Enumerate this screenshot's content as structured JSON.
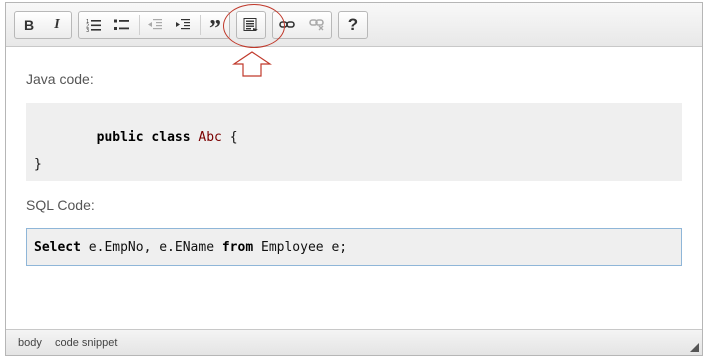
{
  "toolbar": {
    "bold": "B",
    "italic": "I",
    "blockquote": "”",
    "help": "?"
  },
  "content": {
    "java_label": "Java code:",
    "java_code": {
      "line1_kw1": "public",
      "line1_kw2": "class",
      "line1_class": "Abc",
      "line1_brace": "{",
      "line3": "}"
    },
    "sql_label": "SQL Code:",
    "sql_code": {
      "kw1": "Select",
      "part1": " e.EmpNo, e.EName ",
      "kw2": "from",
      "part2": " Employee e;"
    }
  },
  "statusbar": {
    "path": [
      "body",
      "code snippet"
    ]
  },
  "colors": {
    "annotation": "#c0392b",
    "code_bg": "#efefef",
    "selected_border": "#8fb6d8"
  },
  "icons": [
    "bold-icon",
    "italic-icon",
    "numbered-list-icon",
    "bullet-list-icon",
    "outdent-icon",
    "indent-icon",
    "blockquote-icon",
    "code-snippet-icon",
    "link-icon",
    "unlink-icon",
    "help-icon",
    "up-arrow-icon",
    "resize-handle-icon"
  ]
}
